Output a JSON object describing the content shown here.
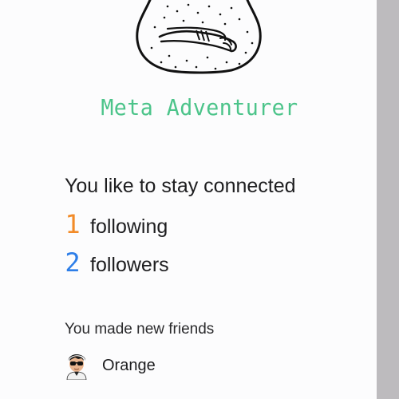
{
  "app": {
    "name": "Meta Adventurer"
  },
  "connections": {
    "title": "You like to stay connected",
    "following": {
      "count": "1",
      "label": "following"
    },
    "followers": {
      "count": "2",
      "label": "followers"
    }
  },
  "friends": {
    "title": "You made new friends",
    "list": [
      {
        "name": "Orange",
        "avatar": "avatar-sunglasses"
      }
    ]
  },
  "colors": {
    "name_green": "#4cc48a",
    "following_orange": "#f28b28",
    "followers_blue": "#2d7ee8",
    "panel": "#fcfcfd",
    "scrollbar_gray": "#bdbbbe"
  }
}
